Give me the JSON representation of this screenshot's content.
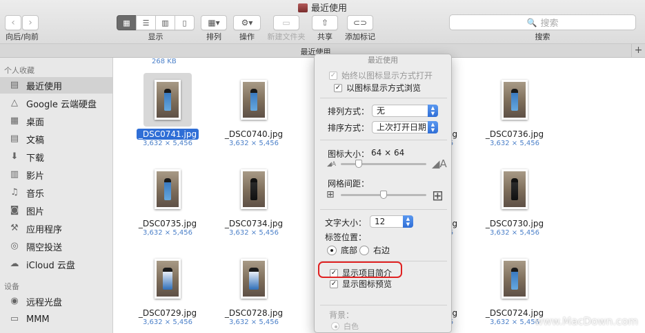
{
  "window": {
    "title": "最近使用"
  },
  "toolbar": {
    "nav_back_icon": "chevron-left",
    "nav_forward_icon": "chevron-right",
    "nav_label": "向后/向前",
    "view_label": "显示",
    "arrange_label": "排列",
    "action_label": "操作",
    "new_folder_label": "新建文件夹",
    "share_label": "共享",
    "add_tag_label": "添加标记",
    "search_placeholder": "搜索",
    "search_label": "搜索"
  },
  "tabbar": {
    "label": "最近使用",
    "plus": "+"
  },
  "sidebar": {
    "favorites_header": "个人收藏",
    "devices_header": "设备",
    "items": [
      {
        "label": "最近使用",
        "icon": "recents-icon",
        "glyph": "▤",
        "selected": true
      },
      {
        "label": "Google 云端硬盘",
        "icon": "google-drive-icon",
        "glyph": "△"
      },
      {
        "label": "桌面",
        "icon": "desktop-icon",
        "glyph": "▦"
      },
      {
        "label": "文稿",
        "icon": "documents-icon",
        "glyph": "▤"
      },
      {
        "label": "下载",
        "icon": "downloads-icon",
        "glyph": "⬇"
      },
      {
        "label": "影片",
        "icon": "movies-icon",
        "glyph": "▥"
      },
      {
        "label": "音乐",
        "icon": "music-icon",
        "glyph": "♫"
      },
      {
        "label": "图片",
        "icon": "pictures-icon",
        "glyph": "◙"
      },
      {
        "label": "应用程序",
        "icon": "applications-icon",
        "glyph": "⚒"
      },
      {
        "label": "隔空投送",
        "icon": "airdrop-icon",
        "glyph": "◎"
      },
      {
        "label": "iCloud 云盘",
        "icon": "icloud-icon",
        "glyph": "☁"
      }
    ],
    "devices": [
      {
        "label": "远程光盘",
        "icon": "remote-disc-icon",
        "glyph": "◉"
      },
      {
        "label": "MMM",
        "icon": "disk-icon",
        "glyph": "▭"
      }
    ]
  },
  "grid": {
    "top_size": "268 KB",
    "files": [
      {
        "name": "_DSC0741.jpg",
        "dims": "3,632 × 5,456",
        "selected": true,
        "figure": "blue"
      },
      {
        "name": "_DSC0740.jpg",
        "dims": "3,632 × 5,456",
        "figure": "blue"
      },
      {
        "name": "_DSC0737.jpg",
        "dims": "3,632 × 5,456",
        "figure": "blue"
      },
      {
        "name": "_DSC0736.jpg",
        "dims": "3,632 × 5,456",
        "figure": "blue"
      },
      {
        "name": "_DSC0735.jpg",
        "dims": "3,632 × 5,456",
        "figure": "blue"
      },
      {
        "name": "_DSC0734.jpg",
        "dims": "3,632 × 5,456",
        "figure": "dark"
      },
      {
        "name": "_DSC0731.jpg",
        "dims": "3,632 × 5,456",
        "figure": "dark"
      },
      {
        "name": "_DSC0730.jpg",
        "dims": "3,632 × 5,456",
        "figure": "dark"
      },
      {
        "name": "_DSC0729.jpg",
        "dims": "3,632 × 5,456",
        "figure": "white"
      },
      {
        "name": "_DSC0728.jpg",
        "dims": "3,632 × 5,456",
        "figure": "white"
      },
      {
        "name": "_DSC0725.jpg",
        "dims": "3,632 × 5,456",
        "figure": "blue"
      },
      {
        "name": "_DSC0724.jpg",
        "dims": "3,632 × 5,456",
        "figure": "blue"
      }
    ]
  },
  "view_options": {
    "title": "最近使用",
    "always_open_icon_view": "始终以图标显示方式打开",
    "always_open_icon_view_checked": true,
    "browse_icon_view": "以图标显示方式浏览",
    "browse_icon_view_checked": true,
    "arrange_by_label": "排列方式：",
    "arrange_by_value": "无",
    "sort_by_label": "排序方式：",
    "sort_by_value": "上次打开日期",
    "icon_size_label": "图标大小：",
    "icon_size_value": "64 × 64",
    "icon_size_fraction": 0.18,
    "grid_spacing_label": "网格间距：",
    "grid_spacing_fraction": 0.5,
    "text_size_label": "文字大小：",
    "text_size_value": "12",
    "label_position_label": "标签位置：",
    "label_bottom": "底部",
    "label_right": "右边",
    "label_position_selected": "底部",
    "show_item_info": "显示项目简介",
    "show_item_info_checked": true,
    "show_icon_preview": "显示图标预览",
    "show_icon_preview_checked": true,
    "background_label": "背景：",
    "background_white": "白色"
  },
  "watermark": "www.MacDown.com",
  "colors": {
    "selection": "#2f6ed6",
    "highlight": "#e02020",
    "dims_text": "#4a7fc8"
  }
}
